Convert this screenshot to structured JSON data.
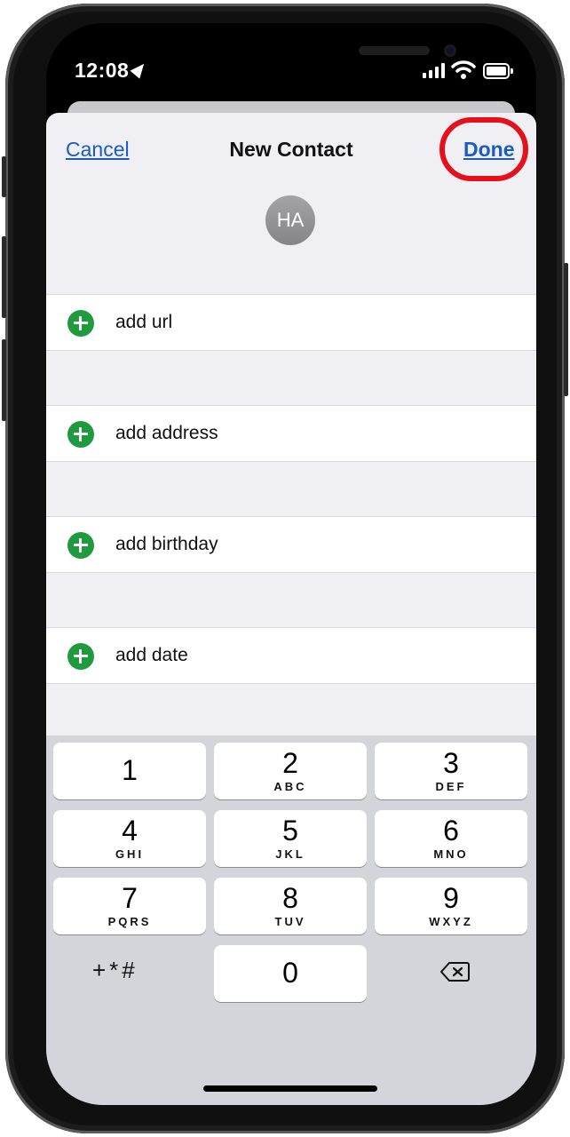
{
  "status_bar": {
    "time": "12:08"
  },
  "nav": {
    "cancel": "Cancel",
    "title": "New Contact",
    "done": "Done"
  },
  "avatar": {
    "initials": "HA"
  },
  "rows": [
    {
      "label": "add url"
    },
    {
      "label": "add address"
    },
    {
      "label": "add birthday"
    },
    {
      "label": "add date"
    }
  ],
  "keypad": {
    "keys": [
      {
        "num": "1",
        "letters": ""
      },
      {
        "num": "2",
        "letters": "ABC"
      },
      {
        "num": "3",
        "letters": "DEF"
      },
      {
        "num": "4",
        "letters": "GHI"
      },
      {
        "num": "5",
        "letters": "JKL"
      },
      {
        "num": "6",
        "letters": "MNO"
      },
      {
        "num": "7",
        "letters": "PQRS"
      },
      {
        "num": "8",
        "letters": "TUV"
      },
      {
        "num": "9",
        "letters": "WXYZ"
      },
      {
        "num": "0",
        "letters": ""
      }
    ],
    "symbols": "+*#"
  },
  "colors": {
    "accent": "#1a5bc4",
    "add_icon": "#1f9a3f",
    "highlight_circle": "#e4111c",
    "sheet_bg": "#efeff4",
    "keyboard_bg": "#d3d5da"
  },
  "icons": {
    "location": "location-arrow-icon",
    "signal": "cellular-signal-icon",
    "wifi": "wifi-icon",
    "battery": "battery-icon",
    "add": "plus-circle-icon",
    "delete": "backspace-icon"
  }
}
